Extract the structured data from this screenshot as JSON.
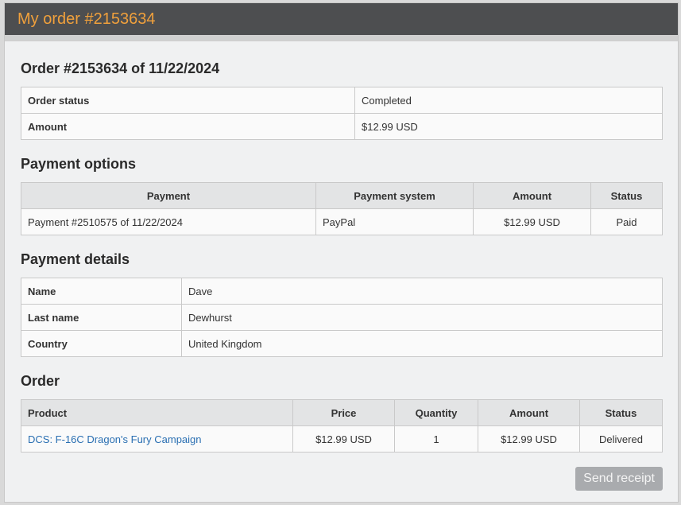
{
  "window": {
    "title": "My order #2153634"
  },
  "order_summary": {
    "heading": "Order #2153634 of 11/22/2024",
    "rows": [
      {
        "label": "Order status",
        "value": "Completed"
      },
      {
        "label": "Amount",
        "value": "$12.99 USD"
      }
    ]
  },
  "payment_options": {
    "heading": "Payment options",
    "columns": [
      "Payment",
      "Payment system",
      "Amount",
      "Status"
    ],
    "rows": [
      {
        "payment": "Payment #2510575 of 11/22/2024",
        "system": "PayPal",
        "amount": "$12.99 USD",
        "status": "Paid"
      }
    ]
  },
  "payment_details": {
    "heading": "Payment details",
    "rows": [
      {
        "label": "Name",
        "value": "Dave"
      },
      {
        "label": "Last name",
        "value": "Dewhurst"
      },
      {
        "label": "Country",
        "value": "United Kingdom"
      }
    ]
  },
  "order": {
    "heading": "Order",
    "columns": [
      "Product",
      "Price",
      "Quantity",
      "Amount",
      "Status"
    ],
    "rows": [
      {
        "product": "DCS: F-16C Dragon's Fury Campaign",
        "price": "$12.99 USD",
        "quantity": "1",
        "amount": "$12.99 USD",
        "status": "Delivered"
      }
    ]
  },
  "actions": {
    "send_receipt": "Send receipt"
  },
  "colors": {
    "title_text": "#f0a03c",
    "titlebar_bg": "#4d4e50",
    "link": "#2a6fb2",
    "button_bg": "#a9abae"
  }
}
